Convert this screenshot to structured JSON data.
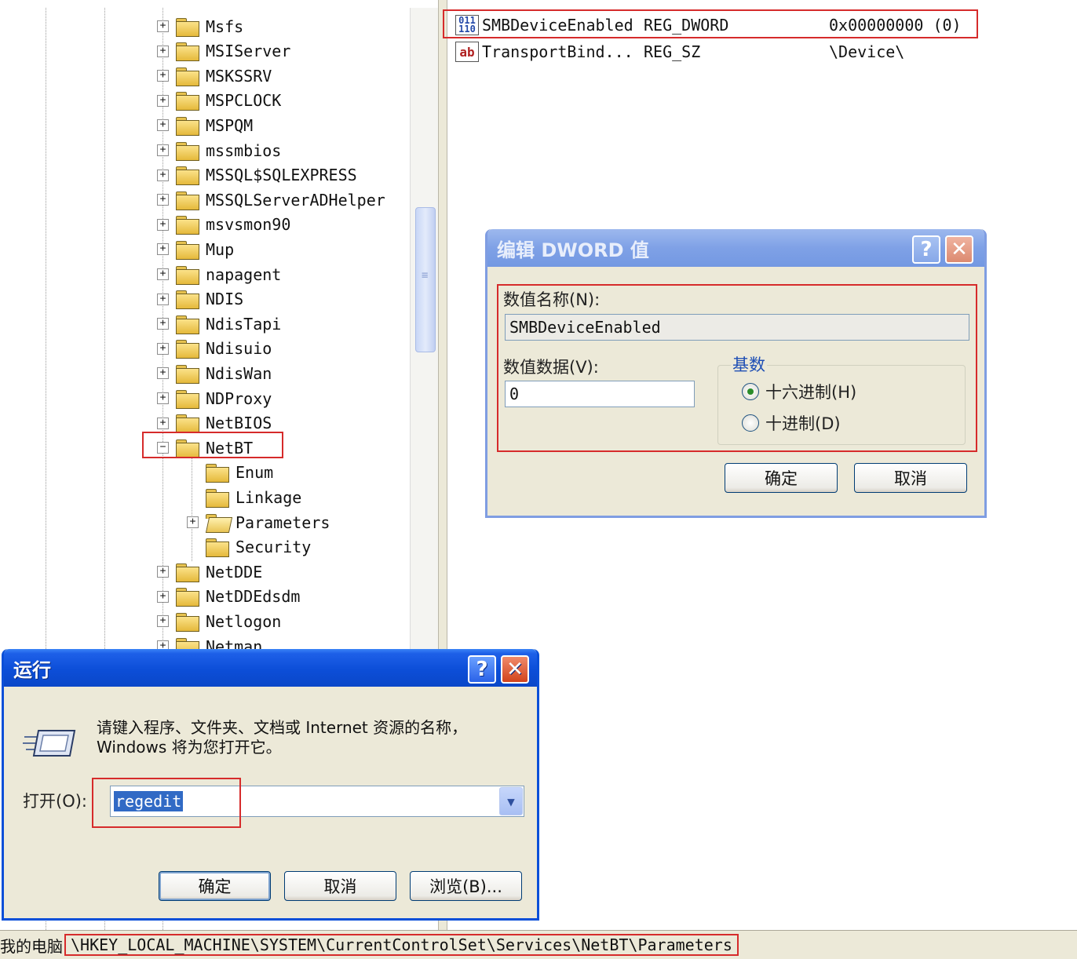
{
  "tree": {
    "items": [
      {
        "label": "Msfs",
        "expander": "+"
      },
      {
        "label": "MSIServer",
        "expander": "+"
      },
      {
        "label": "MSKSSRV",
        "expander": "+"
      },
      {
        "label": "MSPCLOCK",
        "expander": "+"
      },
      {
        "label": "MSPQM",
        "expander": "+"
      },
      {
        "label": "mssmbios",
        "expander": "+"
      },
      {
        "label": "MSSQL$SQLEXPRESS",
        "expander": "+"
      },
      {
        "label": "MSSQLServerADHelper",
        "expander": "+"
      },
      {
        "label": "msvsmon90",
        "expander": "+"
      },
      {
        "label": "Mup",
        "expander": "+"
      },
      {
        "label": "napagent",
        "expander": "+"
      },
      {
        "label": "NDIS",
        "expander": "+"
      },
      {
        "label": "NdisTapi",
        "expander": "+"
      },
      {
        "label": "Ndisuio",
        "expander": "+"
      },
      {
        "label": "NdisWan",
        "expander": "+"
      },
      {
        "label": "NDProxy",
        "expander": "+"
      },
      {
        "label": "NetBIOS",
        "expander": "+"
      },
      {
        "label": "NetBT",
        "expander": "−"
      },
      {
        "label": "Enum",
        "expander": ""
      },
      {
        "label": "Linkage",
        "expander": ""
      },
      {
        "label": "Parameters",
        "expander": "+"
      },
      {
        "label": "Security",
        "expander": ""
      },
      {
        "label": "NetDDE",
        "expander": "+"
      },
      {
        "label": "NetDDEdsdm",
        "expander": "+"
      },
      {
        "label": "Netlogon",
        "expander": "+"
      },
      {
        "label": "Netman",
        "expander": "+"
      }
    ]
  },
  "values": {
    "rows": [
      {
        "icon": "binary-value-icon",
        "icon_text": "011\n110",
        "name": "SMBDeviceEnabled",
        "type": "REG_DWORD",
        "data": "0x00000000 (0)"
      },
      {
        "icon": "string-value-icon",
        "icon_text": "ab",
        "name": "TransportBind...",
        "type": "REG_SZ",
        "data": "\\Device\\"
      }
    ]
  },
  "dword_dialog": {
    "title": "编辑 DWORD 值",
    "help_glyph": "?",
    "close_glyph": "✕",
    "name_label": "数值名称(N):",
    "name_value": "SMBDeviceEnabled",
    "data_label": "数值数据(V):",
    "data_value": "0",
    "base_label": "基数",
    "radio_hex": "十六进制(H)",
    "radio_dec": "十进制(D)",
    "selected_base": "hex",
    "ok_label": "确定",
    "cancel_label": "取消"
  },
  "run_dialog": {
    "title": "运行",
    "help_glyph": "?",
    "close_glyph": "✕",
    "prompt": "请键入程序、文件夹、文档或 Internet 资源的名称，Windows 将为您打开它。",
    "open_label": "打开(O):",
    "open_value": "regedit",
    "dropdown_glyph": "▼",
    "ok_label": "确定",
    "cancel_label": "取消",
    "browse_label": "浏览(B)..."
  },
  "statusbar": {
    "prefix": "我的电脑",
    "path": "\\HKEY_LOCAL_MACHINE\\SYSTEM\\CurrentControlSet\\Services\\NetBT\\Parameters"
  },
  "colors": {
    "highlight_border": "#d62b2b",
    "xp_title_blue": "#0c4ed8",
    "selection_blue": "#316ac5",
    "dialog_face": "#ece9d8"
  }
}
